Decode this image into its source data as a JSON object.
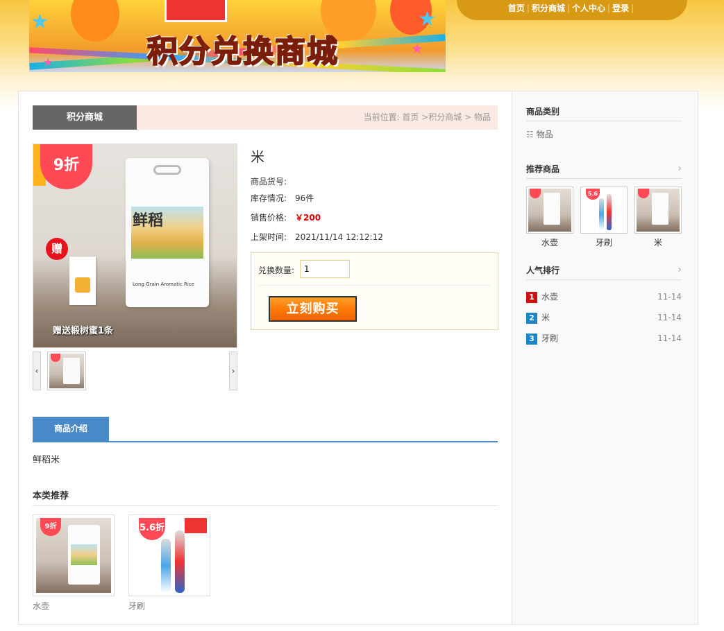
{
  "header": {
    "banner_title": "积分兑换商城",
    "nav": [
      "首页",
      "积分商城",
      "个人中心",
      "登录"
    ],
    "nav_separator": "|"
  },
  "breadcrumb": {
    "section_label": "积分商城",
    "path": "当前位置: 首页 >积分商城 > 物品"
  },
  "product": {
    "name": "米",
    "discount_badge": "9折",
    "gift_badge": "赠",
    "gift_caption": "赠送椴树蜜1条",
    "bag_brand": "鲜稻",
    "bag_subtitle": "Long Grain Aromatic Rice",
    "fields": [
      {
        "key": "商品货号:",
        "value": ""
      },
      {
        "key": "库存情况:",
        "value": "96件"
      },
      {
        "key": "销售价格:",
        "value": "￥200"
      },
      {
        "key": "上架时间:",
        "value": "2021/11/14 12:12:12"
      }
    ],
    "quantity_label": "兑换数量:",
    "quantity_value": "1",
    "buy_button": "立刻购买"
  },
  "thumb_nav": {
    "prev": "‹",
    "next": "›"
  },
  "tabs": [
    {
      "label": "商品介绍",
      "active": true
    }
  ],
  "description": "鲜稻米",
  "same_category": {
    "title": "本类推荐",
    "items": [
      {
        "name": "水壶",
        "badge": "9折"
      },
      {
        "name": "牙刷",
        "badge": "5.6折"
      }
    ]
  },
  "sidebar": {
    "categories": {
      "title": "商品类别",
      "items": [
        "物品"
      ]
    },
    "recommended": {
      "title": "推荐商品",
      "more": "›",
      "items": [
        {
          "name": "水壶",
          "badge": "9折"
        },
        {
          "name": "牙刷",
          "badge": "5.6折"
        },
        {
          "name": "米",
          "badge": "9折"
        }
      ]
    },
    "ranking": {
      "title": "人气排行",
      "more": "›",
      "items": [
        {
          "rank": "1",
          "name": "水壶",
          "date": "11-14",
          "color": "#cc1111"
        },
        {
          "rank": "2",
          "name": "米",
          "date": "11-14",
          "color": "#1a86c8"
        },
        {
          "rank": "3",
          "name": "牙刷",
          "date": "11-14",
          "color": "#1a86c8"
        }
      ]
    }
  },
  "colors": {
    "accent_blue": "#4a89c8",
    "price_red": "#dd0000",
    "buy_orange": "#ff7a08",
    "nav_gold": "#d89a14"
  }
}
